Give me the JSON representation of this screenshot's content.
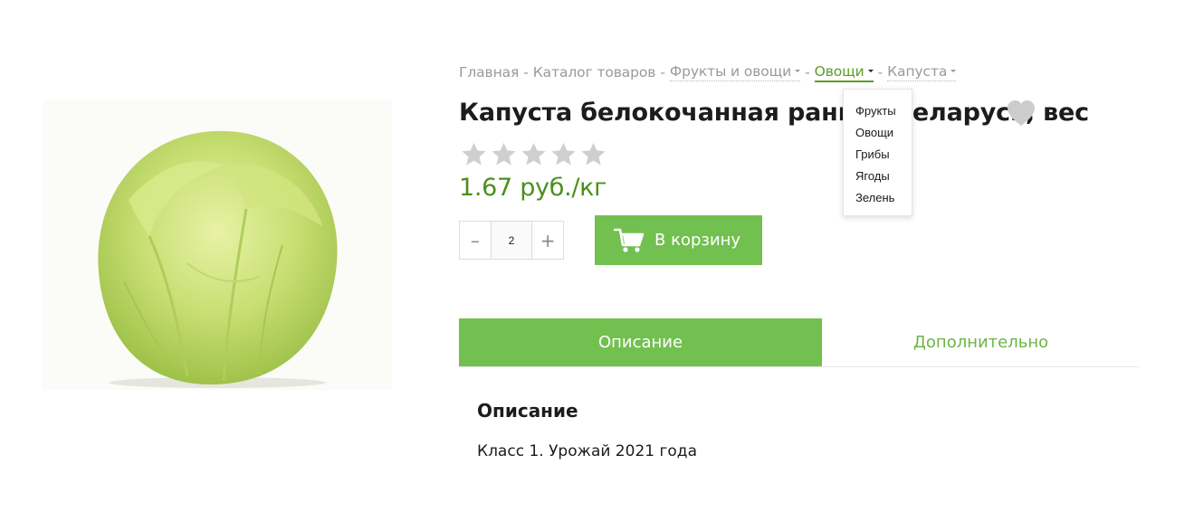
{
  "breadcrumb": {
    "separator": "-",
    "items": [
      {
        "label": "Главная"
      },
      {
        "label": "Каталог товаров"
      },
      {
        "label": "Фрукты и овощи"
      },
      {
        "label": "Овощи"
      },
      {
        "label": "Капуста"
      }
    ]
  },
  "dropdown": {
    "items": [
      "Фрукты",
      "Овощи",
      "Грибы",
      "Ягоды",
      "Зелень"
    ]
  },
  "product": {
    "title": "Капуста белокочанная ранняя Беларусь, вес",
    "price": "1.67 руб./кг",
    "rating": {
      "filled": 0,
      "max": 5
    },
    "quantity": "2",
    "qty_minus": "–",
    "qty_plus": "+",
    "add_to_cart_label": "В корзину"
  },
  "tabs": [
    {
      "label": "Описание",
      "active": true
    },
    {
      "label": "Дополнительно",
      "active": false
    }
  ],
  "description": {
    "heading": "Описание",
    "text": "Класс 1. Урожай 2021 года"
  },
  "icons": {
    "favorite": "heart-icon",
    "rating": "star-icon",
    "cart": "cart-icon",
    "dropdown_caret": "caret-down-icon"
  },
  "colors": {
    "accent": "#72c04f",
    "price": "#4b8f1e",
    "breadcrumb_active": "#5a9e26",
    "muted": "#9a9a9a",
    "star": "#cfcfcf",
    "heart": "#cccccc"
  }
}
